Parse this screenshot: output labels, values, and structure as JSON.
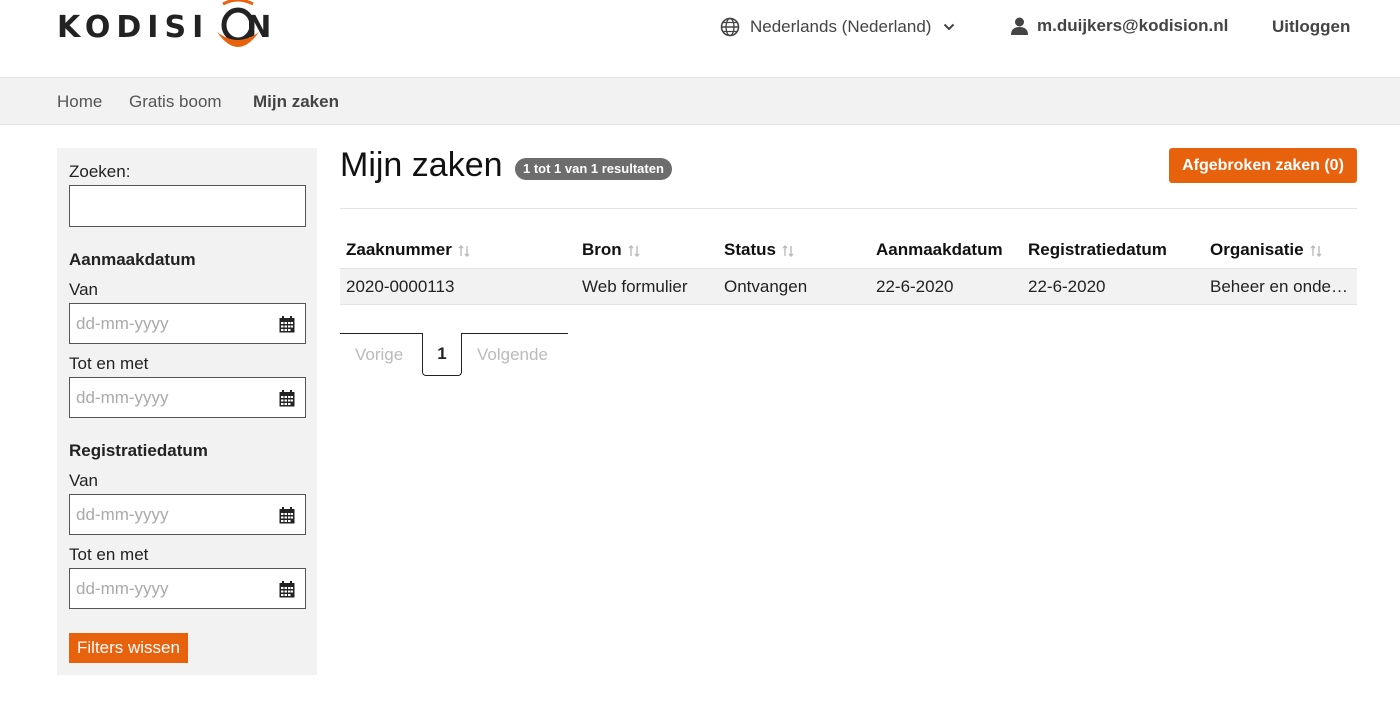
{
  "header": {
    "logo_text": "KODISI",
    "logo_text_end": "N",
    "language": "Nederlands (Nederland)",
    "user_email": "m.duijkers@kodision.nl",
    "logout_label": "Uitloggen"
  },
  "nav": {
    "items": [
      {
        "label": "Home"
      },
      {
        "label": "Gratis boom"
      },
      {
        "label": "Mijn zaken"
      }
    ]
  },
  "sidebar": {
    "search_label": "Zoeken:",
    "search_value": "",
    "creation_heading": "Aanmaakdatum",
    "registration_heading": "Registratiedatum",
    "from_label": "Van",
    "to_label": "Tot en met",
    "date_placeholder": "dd-mm-yyyy",
    "clear_button": "Filters wissen"
  },
  "main": {
    "title": "Mijn zaken",
    "result_badge": "1 tot 1 van 1 resultaten",
    "aborted_button": "Afgebroken zaken (0)"
  },
  "table": {
    "columns": [
      "Zaaknummer",
      "Bron",
      "Status",
      "Aanmaakdatum",
      "Registratiedatum",
      "Organisatie"
    ],
    "rows": [
      [
        "2020-0000113",
        "Web formulier",
        "Ontvangen",
        "22-6-2020",
        "22-6-2020",
        "Beheer en onderhoud"
      ]
    ]
  },
  "pagination": {
    "prev": "Vorige",
    "current": "1",
    "next": "Volgende"
  },
  "colors": {
    "accent": "#e8620e",
    "badge": "#6d6d6d",
    "panel": "#f2f2f2"
  },
  "icons": {
    "language": "globe-icon",
    "dropdown": "chevron-down-icon",
    "user": "user-icon",
    "date": "calendar-icon",
    "sort": "sort-icon"
  }
}
